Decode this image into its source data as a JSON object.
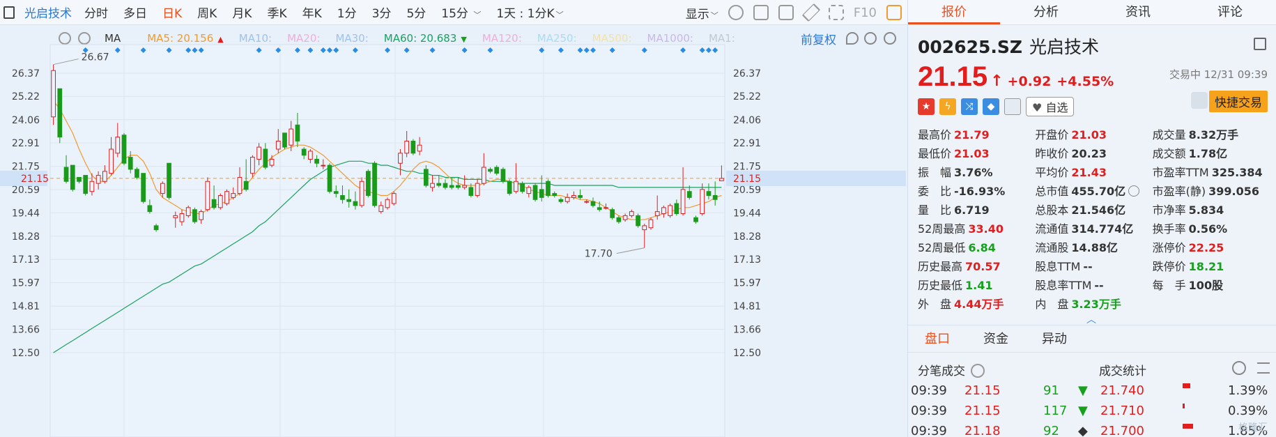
{
  "toolbar": {
    "stock_name": "光启技术",
    "periods": [
      "分时",
      "多日",
      "日K",
      "周K",
      "月K",
      "季K",
      "年K",
      "1分",
      "3分",
      "5分",
      "15分"
    ],
    "active_period": "日K",
    "range_label": "1天 : 1分K",
    "display_label": "显示",
    "f10_label": "F10"
  },
  "ma_bar": {
    "type_label": "MA",
    "items": [
      {
        "label": "MA5:",
        "value": "20.156",
        "color": "#f29a2e",
        "arrow": "▲",
        "arrow_color": "#e21d1d"
      },
      {
        "label": "MA10:",
        "value": "",
        "color": "#9ec3ea",
        "arrow": "",
        "arrow_color": ""
      },
      {
        "label": "MA20:",
        "value": "",
        "color": "#eab0d8",
        "arrow": "",
        "arrow_color": ""
      },
      {
        "label": "MA30:",
        "value": "",
        "color": "#9ec3ea",
        "arrow": "",
        "arrow_color": ""
      },
      {
        "label": "MA60:",
        "value": "20.683",
        "color": "#1aa260",
        "arrow": "▼",
        "arrow_color": "#16a01c"
      },
      {
        "label": "MA120:",
        "value": "",
        "color": "#eab0d8",
        "arrow": "",
        "arrow_color": ""
      },
      {
        "label": "MA250:",
        "value": "",
        "color": "#a8dcf2",
        "arrow": "",
        "arrow_color": ""
      },
      {
        "label": "MA500:",
        "value": "",
        "color": "#f2e2a8",
        "arrow": "",
        "arrow_color": ""
      },
      {
        "label": "MA1000:",
        "value": "",
        "color": "#c8b8ea",
        "arrow": "",
        "arrow_color": ""
      },
      {
        "label": "MA1:",
        "value": "",
        "color": "#c0c8d2",
        "arrow": "",
        "arrow_color": ""
      }
    ],
    "adjust_label": "前复权"
  },
  "chart_data": {
    "type": "candlestick",
    "y_ticks": [
      "26.37",
      "25.22",
      "24.06",
      "22.91",
      "21.75",
      "20.59",
      "19.44",
      "18.28",
      "17.13",
      "15.97",
      "14.81",
      "13.66",
      "12.50"
    ],
    "ylim": [
      12.5,
      26.37
    ],
    "current_price_label": "21.15",
    "current_price": 21.15,
    "high_annotation": "26.67",
    "low_annotation": "17.70",
    "candles": [
      {
        "o": 24.2,
        "h": 26.8,
        "l": 23.8,
        "c": 26.5
      },
      {
        "o": 25.6,
        "h": 25.6,
        "l": 22.9,
        "c": 23.2
      },
      {
        "o": 21.7,
        "h": 22.3,
        "l": 20.9,
        "c": 21.0
      },
      {
        "o": 21.8,
        "h": 21.8,
        "l": 20.5,
        "c": 20.6
      },
      {
        "o": 21.2,
        "h": 21.2,
        "l": 20.9,
        "c": 21.0
      },
      {
        "o": 21.3,
        "h": 21.3,
        "l": 20.3,
        "c": 20.4
      },
      {
        "o": 20.5,
        "h": 21.4,
        "l": 20.3,
        "c": 21.0
      },
      {
        "o": 20.9,
        "h": 21.5,
        "l": 20.6,
        "c": 21.3
      },
      {
        "o": 21.0,
        "h": 21.8,
        "l": 20.9,
        "c": 21.5
      },
      {
        "o": 21.4,
        "h": 23.2,
        "l": 21.3,
        "c": 22.6
      },
      {
        "o": 22.4,
        "h": 23.9,
        "l": 22.2,
        "c": 23.2
      },
      {
        "o": 23.3,
        "h": 23.4,
        "l": 21.8,
        "c": 21.9
      },
      {
        "o": 22.2,
        "h": 22.5,
        "l": 21.4,
        "c": 21.6
      },
      {
        "o": 21.6,
        "h": 21.7,
        "l": 21.1,
        "c": 21.2
      },
      {
        "o": 21.4,
        "h": 21.4,
        "l": 19.9,
        "c": 20.0
      },
      {
        "o": 19.8,
        "h": 20.1,
        "l": 19.4,
        "c": 19.5
      },
      {
        "o": 18.8,
        "h": 18.9,
        "l": 18.5,
        "c": 18.6
      },
      {
        "o": 20.4,
        "h": 21.0,
        "l": 20.2,
        "c": 20.9
      },
      {
        "o": 21.9,
        "h": 21.9,
        "l": 20.1,
        "c": 20.2
      },
      {
        "o": 19.2,
        "h": 19.5,
        "l": 18.7,
        "c": 19.3
      },
      {
        "o": 19.0,
        "h": 19.6,
        "l": 18.8,
        "c": 19.4
      },
      {
        "o": 19.3,
        "h": 19.8,
        "l": 19.2,
        "c": 19.7
      },
      {
        "o": 19.6,
        "h": 19.7,
        "l": 18.9,
        "c": 19.0
      },
      {
        "o": 19.1,
        "h": 19.6,
        "l": 18.9,
        "c": 19.5
      },
      {
        "o": 19.6,
        "h": 21.2,
        "l": 19.5,
        "c": 21.0
      },
      {
        "o": 20.1,
        "h": 20.8,
        "l": 19.6,
        "c": 19.7
      },
      {
        "o": 19.7,
        "h": 20.4,
        "l": 19.6,
        "c": 20.3
      },
      {
        "o": 19.9,
        "h": 20.6,
        "l": 19.8,
        "c": 20.5
      },
      {
        "o": 20.2,
        "h": 20.7,
        "l": 20.1,
        "c": 20.4
      },
      {
        "o": 20.4,
        "h": 21.7,
        "l": 20.3,
        "c": 21.2
      },
      {
        "o": 21.0,
        "h": 22.1,
        "l": 20.5,
        "c": 20.6
      },
      {
        "o": 21.4,
        "h": 22.3,
        "l": 21.2,
        "c": 22.2
      },
      {
        "o": 22.1,
        "h": 22.9,
        "l": 21.8,
        "c": 22.7
      },
      {
        "o": 22.6,
        "h": 22.9,
        "l": 21.6,
        "c": 21.7
      },
      {
        "o": 21.8,
        "h": 22.3,
        "l": 21.7,
        "c": 22.1
      },
      {
        "o": 22.6,
        "h": 23.6,
        "l": 22.4,
        "c": 23.0
      },
      {
        "o": 23.4,
        "h": 23.4,
        "l": 22.6,
        "c": 22.7
      },
      {
        "o": 22.8,
        "h": 24.0,
        "l": 22.5,
        "c": 23.6
      },
      {
        "o": 23.8,
        "h": 24.4,
        "l": 22.7,
        "c": 23.0
      },
      {
        "o": 22.6,
        "h": 22.7,
        "l": 22.1,
        "c": 22.3
      },
      {
        "o": 22.1,
        "h": 22.6,
        "l": 21.9,
        "c": 22.5
      },
      {
        "o": 22.1,
        "h": 22.3,
        "l": 21.7,
        "c": 21.9
      },
      {
        "o": 21.8,
        "h": 22.1,
        "l": 21.6,
        "c": 21.8
      },
      {
        "o": 21.8,
        "h": 21.9,
        "l": 20.4,
        "c": 20.5
      },
      {
        "o": 20.5,
        "h": 20.8,
        "l": 20.2,
        "c": 20.4
      },
      {
        "o": 20.3,
        "h": 20.8,
        "l": 19.9,
        "c": 20.1
      },
      {
        "o": 20.1,
        "h": 20.6,
        "l": 19.7,
        "c": 20.0
      },
      {
        "o": 20.0,
        "h": 20.5,
        "l": 19.6,
        "c": 19.8
      },
      {
        "o": 19.8,
        "h": 21.2,
        "l": 19.7,
        "c": 21.0
      },
      {
        "o": 21.5,
        "h": 21.6,
        "l": 20.2,
        "c": 20.3
      },
      {
        "o": 21.9,
        "h": 22.0,
        "l": 19.7,
        "c": 19.8
      },
      {
        "o": 19.5,
        "h": 20.0,
        "l": 19.4,
        "c": 19.8
      },
      {
        "o": 19.7,
        "h": 20.2,
        "l": 19.6,
        "c": 20.1
      },
      {
        "o": 19.9,
        "h": 20.5,
        "l": 19.8,
        "c": 20.4
      },
      {
        "o": 21.9,
        "h": 22.6,
        "l": 21.3,
        "c": 22.4
      },
      {
        "o": 22.4,
        "h": 23.5,
        "l": 22.2,
        "c": 23.0
      },
      {
        "o": 23.0,
        "h": 23.1,
        "l": 22.3,
        "c": 22.4
      },
      {
        "o": 22.5,
        "h": 23.2,
        "l": 22.3,
        "c": 22.8
      },
      {
        "o": 21.6,
        "h": 21.8,
        "l": 20.7,
        "c": 20.8
      },
      {
        "o": 20.7,
        "h": 21.3,
        "l": 20.5,
        "c": 20.9
      },
      {
        "o": 20.9,
        "h": 21.3,
        "l": 20.7,
        "c": 20.8
      },
      {
        "o": 20.9,
        "h": 21.1,
        "l": 20.6,
        "c": 20.7
      },
      {
        "o": 20.8,
        "h": 21.2,
        "l": 20.6,
        "c": 20.7
      },
      {
        "o": 20.8,
        "h": 21.2,
        "l": 20.6,
        "c": 20.7
      },
      {
        "o": 20.7,
        "h": 21.3,
        "l": 20.6,
        "c": 20.8
      },
      {
        "o": 20.7,
        "h": 20.9,
        "l": 20.2,
        "c": 20.3
      },
      {
        "o": 20.3,
        "h": 21.1,
        "l": 20.2,
        "c": 20.9
      },
      {
        "o": 20.9,
        "h": 22.4,
        "l": 20.8,
        "c": 21.7
      },
      {
        "o": 21.6,
        "h": 21.7,
        "l": 21.4,
        "c": 21.5
      },
      {
        "o": 21.7,
        "h": 21.8,
        "l": 21.3,
        "c": 21.4
      },
      {
        "o": 21.6,
        "h": 21.7,
        "l": 20.9,
        "c": 21.0
      },
      {
        "o": 21.0,
        "h": 21.1,
        "l": 20.3,
        "c": 20.4
      },
      {
        "o": 20.5,
        "h": 21.9,
        "l": 20.4,
        "c": 21.0
      },
      {
        "o": 20.9,
        "h": 21.0,
        "l": 20.4,
        "c": 20.5
      },
      {
        "o": 20.4,
        "h": 20.8,
        "l": 20.2,
        "c": 20.7
      },
      {
        "o": 20.8,
        "h": 20.9,
        "l": 20.0,
        "c": 20.1
      },
      {
        "o": 20.6,
        "h": 21.3,
        "l": 20.0,
        "c": 20.2
      },
      {
        "o": 21.0,
        "h": 21.1,
        "l": 20.2,
        "c": 20.3
      },
      {
        "o": 20.4,
        "h": 20.5,
        "l": 20.2,
        "c": 20.3
      },
      {
        "o": 20.1,
        "h": 20.2,
        "l": 19.9,
        "c": 20.0
      },
      {
        "o": 20.0,
        "h": 20.4,
        "l": 19.9,
        "c": 20.2
      },
      {
        "o": 20.2,
        "h": 20.5,
        "l": 20.1,
        "c": 20.3
      },
      {
        "o": 20.3,
        "h": 20.6,
        "l": 20.1,
        "c": 20.2
      },
      {
        "o": 20.0,
        "h": 20.1,
        "l": 19.9,
        "c": 20.0
      },
      {
        "o": 20.0,
        "h": 20.2,
        "l": 19.7,
        "c": 19.8
      },
      {
        "o": 19.7,
        "h": 20.0,
        "l": 19.5,
        "c": 19.6
      },
      {
        "o": 19.7,
        "h": 19.9,
        "l": 19.6,
        "c": 19.7
      },
      {
        "o": 19.6,
        "h": 19.7,
        "l": 19.1,
        "c": 19.2
      },
      {
        "o": 19.2,
        "h": 19.3,
        "l": 18.9,
        "c": 19.0
      },
      {
        "o": 19.1,
        "h": 19.4,
        "l": 19.0,
        "c": 19.3
      },
      {
        "o": 19.3,
        "h": 19.6,
        "l": 19.2,
        "c": 19.5
      },
      {
        "o": 19.3,
        "h": 19.4,
        "l": 18.7,
        "c": 18.8
      },
      {
        "o": 18.6,
        "h": 18.9,
        "l": 17.7,
        "c": 18.8
      },
      {
        "o": 18.7,
        "h": 19.2,
        "l": 18.6,
        "c": 19.1
      },
      {
        "o": 19.3,
        "h": 20.3,
        "l": 19.1,
        "c": 19.5
      },
      {
        "o": 19.4,
        "h": 19.8,
        "l": 19.2,
        "c": 19.7
      },
      {
        "o": 19.3,
        "h": 19.9,
        "l": 19.2,
        "c": 19.8
      },
      {
        "o": 19.9,
        "h": 20.1,
        "l": 19.3,
        "c": 19.4
      },
      {
        "o": 19.4,
        "h": 21.7,
        "l": 19.3,
        "c": 20.6
      },
      {
        "o": 20.5,
        "h": 20.8,
        "l": 20.1,
        "c": 20.2
      },
      {
        "o": 19.2,
        "h": 19.3,
        "l": 18.9,
        "c": 19.0
      },
      {
        "o": 19.4,
        "h": 20.9,
        "l": 19.3,
        "c": 20.6
      },
      {
        "o": 20.5,
        "h": 20.9,
        "l": 20.1,
        "c": 20.3
      },
      {
        "o": 20.3,
        "h": 21.0,
        "l": 19.8,
        "c": 20.1
      },
      {
        "o": 21.03,
        "h": 21.79,
        "l": 21.03,
        "c": 21.15
      }
    ],
    "ma5": [
      25.0,
      24.6,
      24.0,
      23.4,
      22.6,
      21.9,
      21.3,
      21.0,
      21.0,
      21.3,
      21.7,
      22.1,
      22.3,
      22.3,
      22.0,
      21.4,
      20.6,
      20.2,
      20.0,
      19.8,
      19.6,
      19.5,
      19.4,
      19.4,
      19.6,
      19.8,
      19.9,
      20.0,
      20.2,
      20.4,
      20.8,
      21.2,
      21.6,
      21.9,
      22.2,
      22.4,
      22.6,
      22.7,
      22.8,
      22.8,
      22.7,
      22.5,
      22.3,
      22.0,
      21.7,
      21.4,
      21.1,
      20.8,
      20.6,
      20.5,
      20.4,
      20.3,
      20.3,
      20.5,
      20.8,
      21.2,
      21.6,
      21.9,
      22.0,
      21.9,
      21.7,
      21.4,
      21.1,
      20.9,
      20.8,
      20.8,
      20.8,
      20.9,
      21.0,
      21.1,
      21.1,
      21.0,
      20.9,
      20.8,
      20.6,
      20.5,
      20.4,
      20.3,
      20.3,
      20.3,
      20.2,
      20.2,
      20.1,
      20.1,
      20.0,
      19.9,
      19.7,
      19.5,
      19.3,
      19.2,
      19.1,
      19.1,
      19.1,
      19.2,
      19.3,
      19.4,
      19.5,
      19.6,
      19.7,
      19.7,
      19.8,
      19.9,
      20.0,
      20.2,
      20.3
    ],
    "ma60": [
      12.5,
      12.7,
      12.9,
      13.1,
      13.3,
      13.5,
      13.7,
      13.9,
      14.1,
      14.3,
      14.5,
      14.7,
      14.9,
      15.1,
      15.3,
      15.5,
      15.7,
      15.9,
      16.0,
      16.2,
      16.4,
      16.6,
      16.8,
      16.9,
      17.1,
      17.3,
      17.5,
      17.7,
      17.9,
      18.1,
      18.3,
      18.5,
      18.8,
      19.0,
      19.3,
      19.6,
      19.9,
      20.2,
      20.5,
      20.8,
      21.1,
      21.3,
      21.5,
      21.7,
      21.8,
      21.9,
      22.0,
      22.0,
      22.0,
      21.9,
      21.9,
      21.8,
      21.8,
      21.7,
      21.6,
      21.5,
      21.5,
      21.4,
      21.4,
      21.3,
      21.3,
      21.2,
      21.2,
      21.2,
      21.1,
      21.1,
      21.1,
      21.1,
      21.0,
      21.0,
      21.0,
      21.0,
      20.9,
      20.9,
      20.9,
      20.9,
      20.9,
      20.9,
      20.8,
      20.8,
      20.8,
      20.8,
      20.8,
      20.8,
      20.8,
      20.8,
      20.8,
      20.8,
      20.7,
      20.7,
      20.7,
      20.7,
      20.7,
      20.7,
      20.7,
      20.7,
      20.7,
      20.7,
      20.7,
      20.7,
      20.7,
      20.7,
      20.7,
      20.7,
      20.7
    ],
    "marker_indices": [
      5,
      10,
      14,
      18,
      21,
      22,
      23,
      32,
      35,
      38,
      40,
      42,
      43,
      44,
      47,
      52,
      55,
      59,
      64,
      68,
      76,
      79,
      82,
      83,
      84,
      87,
      92,
      98,
      101,
      102,
      103
    ]
  },
  "panel": {
    "tabs": [
      "报价",
      "分析",
      "资讯",
      "评论"
    ],
    "active_tab": "报价",
    "code": "002625.SZ",
    "name": "光启技术",
    "price": "21.15",
    "change": "+0.92",
    "change_pct": "+4.55%",
    "trade_status": "交易中 12/31 09:39",
    "fav_label": "自选",
    "quick_trade_label": "快捷交易",
    "stats": [
      [
        {
          "label": "最高价",
          "value": "21.79",
          "cls": "red"
        },
        {
          "label": "开盘价",
          "value": "21.03",
          "cls": "red"
        },
        {
          "label": "成交量",
          "value": "8.32万手",
          "cls": "dark"
        }
      ],
      [
        {
          "label": "最低价",
          "value": "21.03",
          "cls": "red"
        },
        {
          "label": "昨收价",
          "value": "20.23",
          "cls": "dark"
        },
        {
          "label": "成交额",
          "value": "1.78亿",
          "cls": "dark"
        }
      ],
      [
        {
          "label": "振　幅",
          "value": "3.76%",
          "cls": "dark"
        },
        {
          "label": "平均价",
          "value": "21.43",
          "cls": "red"
        },
        {
          "label": "市盈率TTM",
          "value": "325.384",
          "cls": "dark"
        }
      ],
      [
        {
          "label": "委　比",
          "value": "-16.93%",
          "cls": "dark"
        },
        {
          "label": "总市值",
          "value": "455.70亿",
          "cls": "dark"
        },
        {
          "label": "市盈率(静)",
          "value": "399.056",
          "cls": "dark"
        }
      ],
      [
        {
          "label": "量　比",
          "value": "6.719",
          "cls": "dark"
        },
        {
          "label": "总股本",
          "value": "21.546亿",
          "cls": "dark"
        },
        {
          "label": "市净率",
          "value": "5.834",
          "cls": "dark"
        }
      ],
      [
        {
          "label": "52周最高",
          "value": "33.40",
          "cls": "red"
        },
        {
          "label": "流通值",
          "value": "314.774亿",
          "cls": "dark"
        },
        {
          "label": "换手率",
          "value": "0.56%",
          "cls": "dark"
        }
      ],
      [
        {
          "label": "52周最低",
          "value": "6.84",
          "cls": "green"
        },
        {
          "label": "流通股",
          "value": "14.88亿",
          "cls": "dark"
        },
        {
          "label": "涨停价",
          "value": "22.25",
          "cls": "red"
        }
      ],
      [
        {
          "label": "历史最高",
          "value": "70.57",
          "cls": "red"
        },
        {
          "label": "股息TTM",
          "value": "--",
          "cls": "dark"
        },
        {
          "label": "跌停价",
          "value": "18.21",
          "cls": "green"
        }
      ],
      [
        {
          "label": "历史最低",
          "value": "1.41",
          "cls": "green"
        },
        {
          "label": "股息率TTM",
          "value": "--",
          "cls": "dark"
        },
        {
          "label": "每　手",
          "value": "100股",
          "cls": "dark"
        }
      ],
      [
        {
          "label": "外　盘",
          "value": "4.44万手",
          "cls": "red"
        },
        {
          "label": "内　盘",
          "value": "3.23万手",
          "cls": "green"
        },
        {
          "label": "",
          "value": "",
          "cls": "dark"
        }
      ]
    ],
    "subtabs": [
      "盘口",
      "资金",
      "异动"
    ],
    "active_subtab": "盘口",
    "ticks_title": "分笔成交",
    "stats_title": "成交统计",
    "ticks": [
      {
        "time": "09:39",
        "price": "21.15",
        "vol": "91",
        "dir": "▼",
        "dir_color": "#16a01c"
      },
      {
        "time": "09:39",
        "price": "21.15",
        "vol": "117",
        "dir": "▼",
        "dir_color": "#16a01c"
      },
      {
        "time": "09:39",
        "price": "21.18",
        "vol": "92",
        "dir": "◆",
        "dir_color": "#333"
      }
    ],
    "deal_stats": [
      {
        "price": "21.740",
        "pct": "1.39%",
        "share": 0.0139
      },
      {
        "price": "21.710",
        "pct": "0.39%",
        "share": 0.0039
      },
      {
        "price": "21.700",
        "pct": "1.85%",
        "share": 0.0185
      }
    ],
    "watermark": "格隆汇"
  }
}
